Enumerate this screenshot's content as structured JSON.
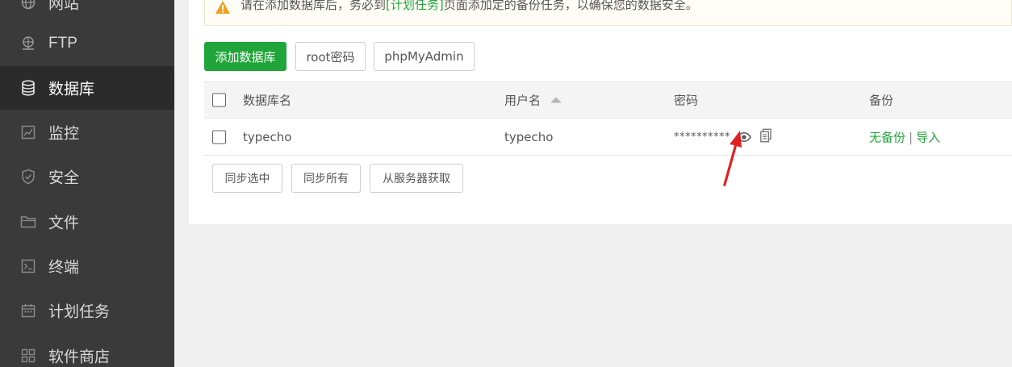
{
  "sidebar": {
    "items": [
      {
        "label": "网站",
        "icon": "globe-icon"
      },
      {
        "label": "FTP",
        "icon": "ftp-icon"
      },
      {
        "label": "数据库",
        "icon": "database-icon",
        "active": true
      },
      {
        "label": "监控",
        "icon": "monitor-icon"
      },
      {
        "label": "安全",
        "icon": "shield-icon"
      },
      {
        "label": "文件",
        "icon": "folder-icon"
      },
      {
        "label": "终端",
        "icon": "terminal-icon"
      },
      {
        "label": "计划任务",
        "icon": "calendar-icon"
      },
      {
        "label": "软件商店",
        "icon": "grid-icon"
      }
    ]
  },
  "notice": {
    "text_before": "请在添加数据库后，务必到",
    "link": "[计划任务]",
    "text_after": "页面添加定的备份任务，以确保您的数据安全。",
    "icon": "warning-icon",
    "icon_color": "#f0a020"
  },
  "toolbar": {
    "add_db": "添加数据库",
    "root_password": "root密码",
    "phpmyadmin": "phpMyAdmin"
  },
  "table": {
    "headers": {
      "name": "数据库名",
      "user": "用户名",
      "password": "密码",
      "backup": "备份"
    },
    "rows": [
      {
        "name": "typecho",
        "user": "typecho",
        "password": "**********",
        "backup_status": "无备份",
        "separator": "|",
        "import": "导入"
      }
    ]
  },
  "bottom_actions": {
    "sync_selected": "同步选中",
    "sync_all": "同步所有",
    "fetch_from_server": "从服务器获取"
  },
  "colors": {
    "accent": "#20a53a",
    "sidebar_bg": "#3a3a3a",
    "annotation_arrow": "#e02020"
  }
}
